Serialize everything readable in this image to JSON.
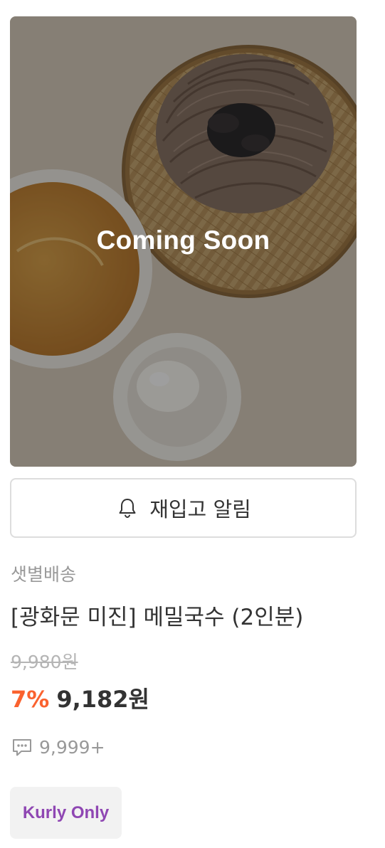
{
  "product": {
    "image_overlay_text": "Coming Soon",
    "restock_button": {
      "label": "재입고 알림",
      "icon": "bell-icon"
    },
    "delivery_type": "샛별배송",
    "name": "[광화문 미진] 메밀국수 (2인분)",
    "original_price": "9,980원",
    "discount_rate": "7%",
    "sale_price": "9,182원",
    "review": {
      "icon": "speech-bubble-icon",
      "count": "9,999+"
    },
    "badge": "Kurly Only"
  },
  "colors": {
    "discount": "#fa622f",
    "badge_text": "#8f47b3",
    "badge_bg": "#f2f2f2",
    "muted_text": "#999999",
    "primary_text": "#333333"
  }
}
